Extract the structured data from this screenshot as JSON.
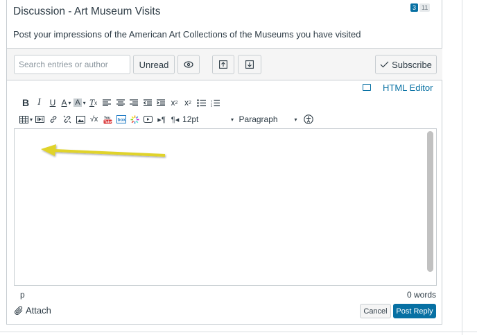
{
  "discussion": {
    "title": "Discussion - Art Museum Visits",
    "badge_unread": "3",
    "badge_total": "11",
    "prompt": "Post your impressions of the American Art Collections of the Museums you have visited"
  },
  "toolbar": {
    "search_placeholder": "Search entries or author",
    "unread_label": "Unread",
    "subscribe_label": "Subscribe"
  },
  "editor": {
    "html_editor_label": "HTML Editor",
    "font_size": "12pt",
    "block_format": "Paragraph",
    "status_path": "p",
    "word_count": "0 words"
  },
  "actions": {
    "attach_label": "Attach",
    "cancel_label": "Cancel",
    "post_label": "Post Reply"
  },
  "colors": {
    "accent": "#0770a3",
    "arrow": "#e0d32b"
  }
}
